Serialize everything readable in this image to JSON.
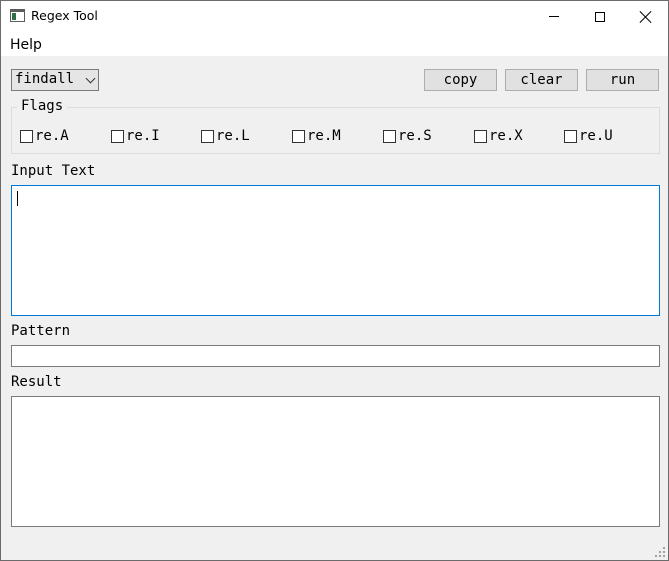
{
  "window": {
    "title": "Regex Tool",
    "icon": "app-window-icon",
    "controls": [
      "minimize-icon",
      "maximize-icon",
      "close-icon"
    ]
  },
  "menu": {
    "help": "Help"
  },
  "toolbar": {
    "mode_selected": "findall",
    "copy_label": "copy",
    "clear_label": "clear",
    "run_label": "run"
  },
  "flags": {
    "title": "Flags",
    "items": [
      {
        "label": "re.A",
        "checked": false
      },
      {
        "label": "re.I",
        "checked": false
      },
      {
        "label": "re.L",
        "checked": false
      },
      {
        "label": "re.M",
        "checked": false
      },
      {
        "label": "re.S",
        "checked": false
      },
      {
        "label": "re.X",
        "checked": false
      },
      {
        "label": "re.U",
        "checked": false
      }
    ]
  },
  "input_text": {
    "label": "Input Text",
    "value": ""
  },
  "pattern": {
    "label": "Pattern",
    "value": ""
  },
  "result": {
    "label": "Result",
    "value": ""
  },
  "colors": {
    "window_bg": "#f0f0f0",
    "focus_border": "#0078d7",
    "button_bg": "#e1e1e1"
  }
}
